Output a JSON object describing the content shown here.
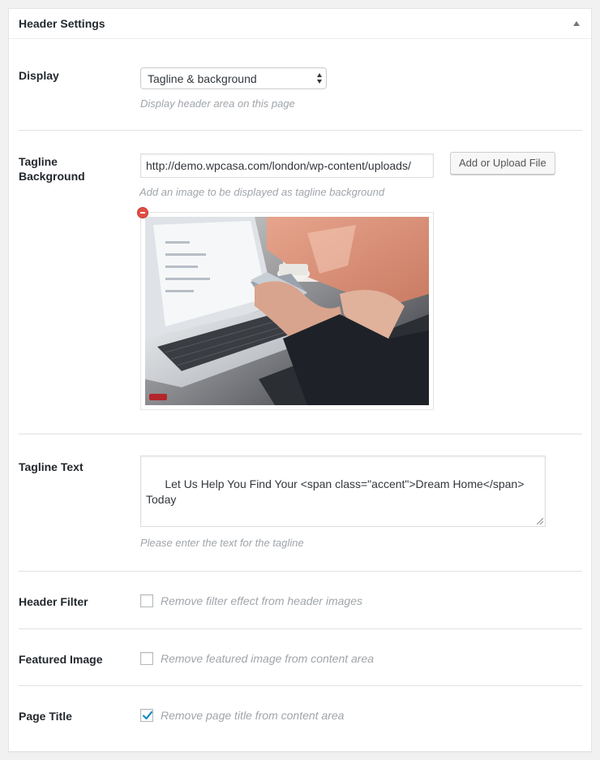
{
  "metabox": {
    "title": "Header Settings"
  },
  "display": {
    "label": "Display",
    "selected": "Tagline & background",
    "description": "Display header area on this page"
  },
  "tagline_background": {
    "label_line1": "Tagline",
    "label_line2": "Background",
    "url_value": "http://demo.wpcasa.com/london/wp-content/uploads/",
    "upload_button": "Add or Upload File",
    "description": "Add an image to be displayed as tagline background"
  },
  "tagline_text": {
    "label": "Tagline Text",
    "value": "Let Us Help You Find Your <span class=\"accent\">Dream Home</span>\nToday",
    "description": "Please enter the text for the tagline"
  },
  "header_filter": {
    "label": "Header Filter",
    "checkbox_label": "Remove filter effect from header images",
    "checked": false
  },
  "featured_image": {
    "label": "Featured Image",
    "checkbox_label": "Remove featured image from content area",
    "checked": false
  },
  "page_title": {
    "label": "Page Title",
    "checkbox_label": "Remove page title from content area",
    "checked": true
  },
  "colors": {
    "accent": "#0073aa",
    "remove": "#e14d43",
    "description": "#a0a5aa"
  },
  "icons": {
    "toggle": "arrow-up-icon",
    "remove": "remove-circle-icon",
    "checkmark": "checkmark-icon"
  }
}
